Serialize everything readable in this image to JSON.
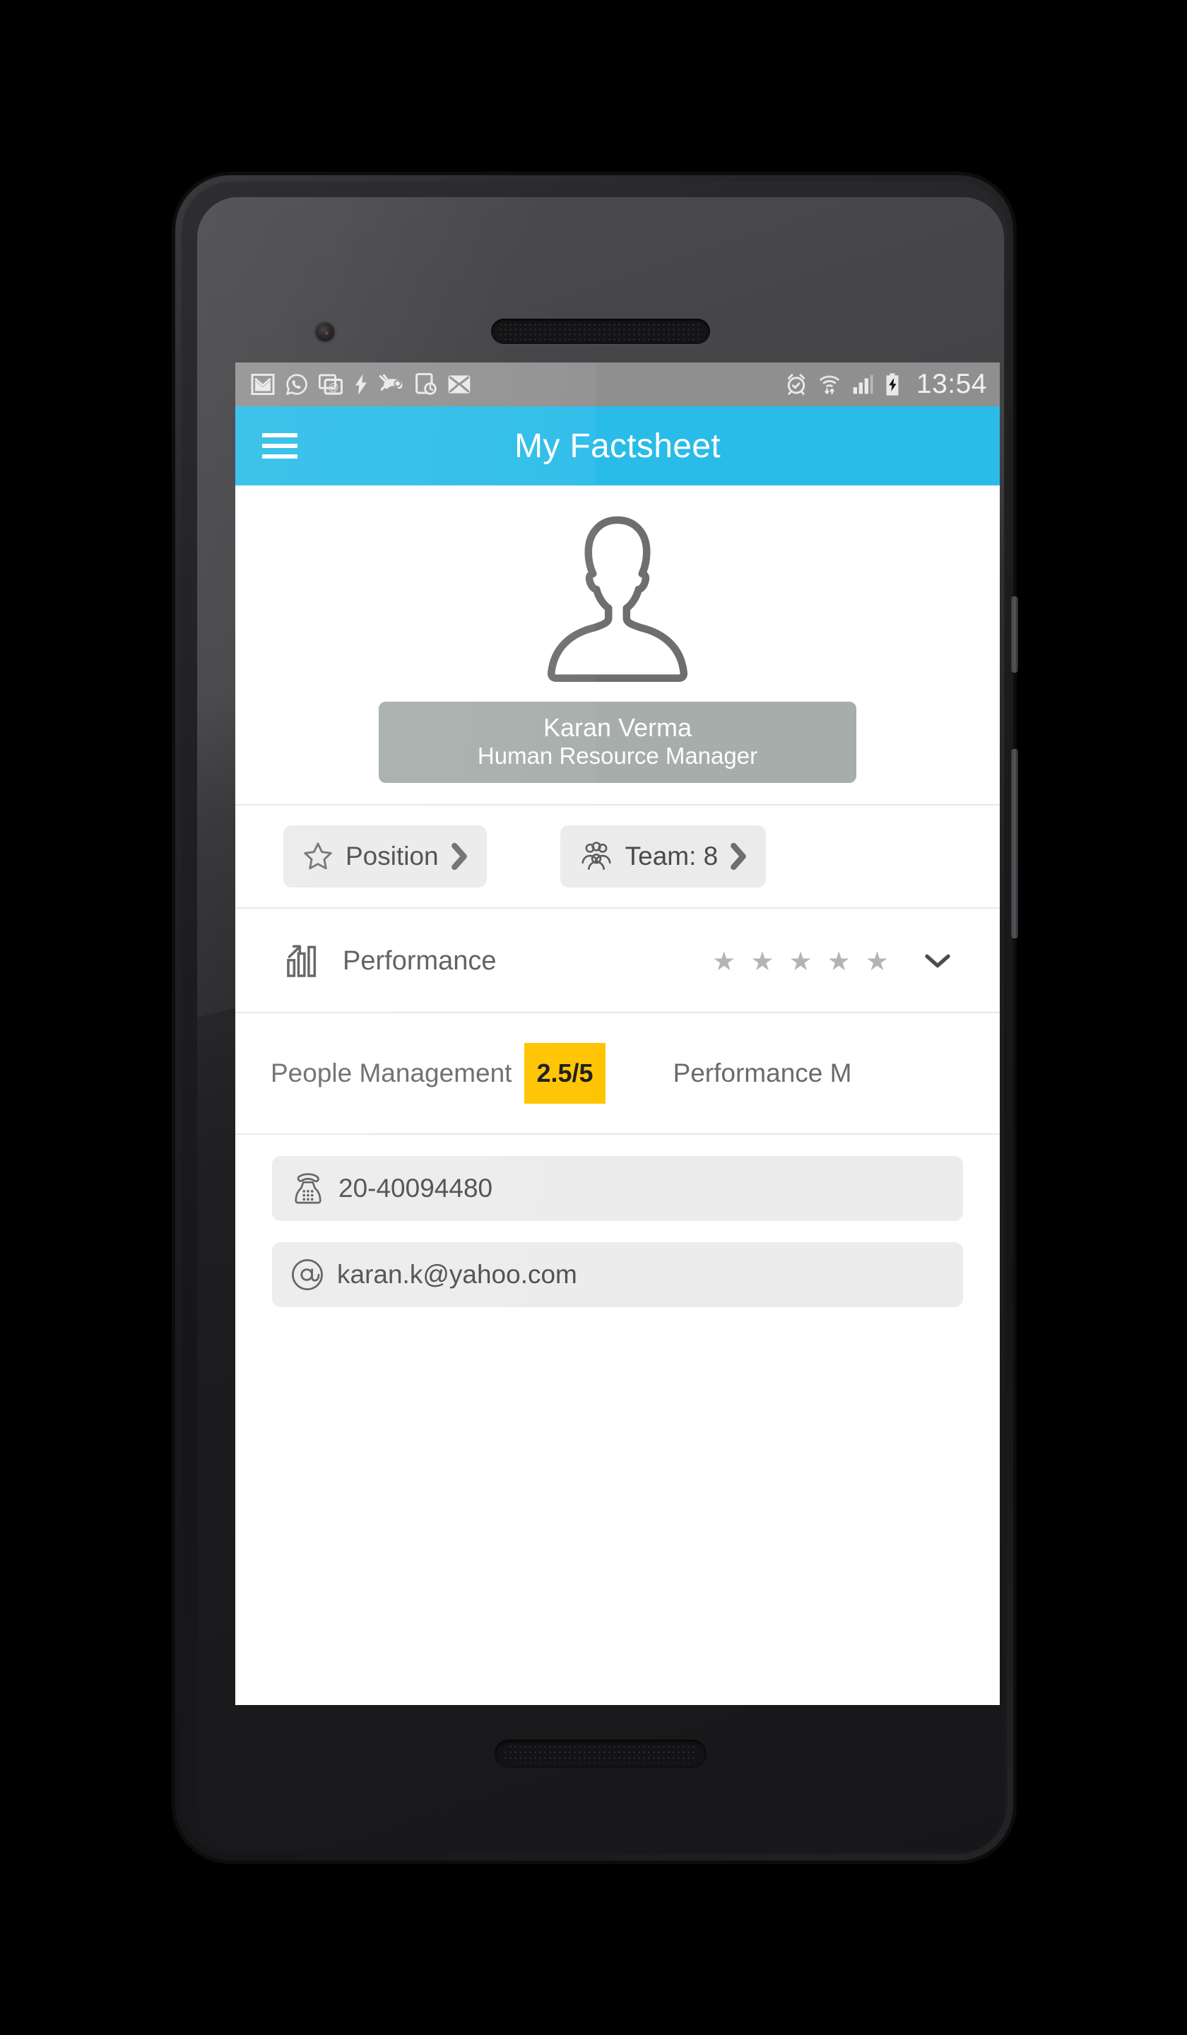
{
  "statusbar": {
    "time": "13:54",
    "left_icons": [
      "gmail-icon",
      "whatsapp-icon",
      "screenshot-icon",
      "flash-icon",
      "game-tools-icon",
      "device-clock-icon",
      "mail-x-icon"
    ],
    "right_icons": [
      "alarm-icon",
      "wifi-icon",
      "signal-icon",
      "battery-charging-icon"
    ]
  },
  "appbar": {
    "menu_icon": "hamburger-menu-icon",
    "title": "My Factsheet",
    "background_color": "#29bce8"
  },
  "profile": {
    "avatar_icon": "person-silhouette-icon",
    "name": "Karan Verma",
    "role": "Human Resource Manager",
    "card_color": "#a6adab"
  },
  "chips": [
    {
      "icon": "star-outline-icon",
      "label": "Position",
      "chevron": "chevron-right-icon"
    },
    {
      "icon": "group-people-icon",
      "label": "Team: 8",
      "chevron": "chevron-right-icon"
    }
  ],
  "performance": {
    "icon": "bar-chart-up-icon",
    "label": "Performance",
    "stars": [
      "★",
      "★",
      "★",
      "★",
      "★"
    ],
    "star_color": "#b4b4b4",
    "expand_icon": "chevron-down-icon"
  },
  "metrics": {
    "items": [
      {
        "name": "People Management",
        "score": "2.5/5",
        "badge_color": "#ffc400"
      },
      {
        "name": "Performance M",
        "score": ""
      }
    ]
  },
  "contacts": [
    {
      "icon": "telephone-icon",
      "value": "20-40094480"
    },
    {
      "icon": "at-sign-icon",
      "value": "karan.k@yahoo.com"
    }
  ]
}
